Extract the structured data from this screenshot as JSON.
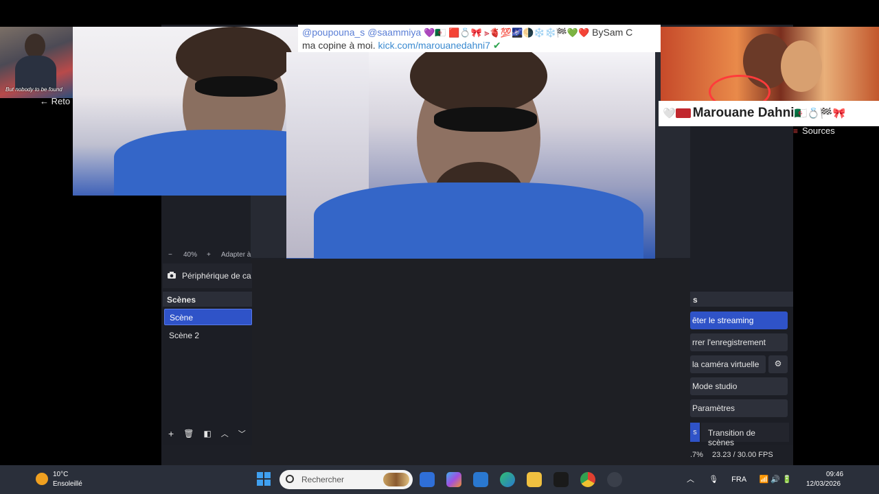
{
  "overlay": {
    "profile_caption": "But nobody to be found",
    "back_label": "← Reto",
    "chat": {
      "mention1": "@poupouna_s",
      "mention2": "@saammiya",
      "emojis": "💜🇩🇿 🟥💍🎀 ⫸🫀💯🌌🌗❄️❄️🏁💚❤️",
      "by": "BySam C",
      "line2_text": "ma copine à moi.",
      "line2_link": "kick.com/marouanedahni7",
      "verified": "✔"
    },
    "name_banner": {
      "prefix": "🤍",
      "name": "Marouane Dahni",
      "suffix": "🇩🇿💍🏁🎀"
    }
  },
  "obs": {
    "zoom": {
      "minus": "−",
      "value": "40%",
      "plus": "+",
      "fit": "Adapter à"
    },
    "source_toolbar": {
      "camera_label": "Périphérique de ca"
    },
    "scenes": {
      "title": "Scènes",
      "items": [
        {
          "label": "Scène"
        },
        {
          "label": "Scène 2"
        }
      ],
      "toolbar": {
        "add": "+",
        "remove": "🗑",
        "filter": "◧",
        "up": "︿",
        "down": "﹀"
      }
    },
    "sources_label": "Sources",
    "controls": {
      "title": "s",
      "stream": "êter le streaming",
      "record": "rrer l'enregistrement",
      "vcam": "la caméra virtuelle",
      "vcam_settings": "⚙",
      "studio": "Mode studio",
      "settings": "Paramètres"
    },
    "dock_tabs": {
      "left": "s",
      "transition": "Transition de scènes"
    },
    "status": {
      "cpu": ".7%",
      "fps": "23.23 / 30.00 FPS"
    }
  },
  "taskbar": {
    "weather_temp": "10°C",
    "weather_desc": "Ensoleillé",
    "search_placeholder": "Rechercher",
    "language": "FRA",
    "time": "09:46",
    "date": "12/03/2026"
  },
  "colors": {
    "accent": "#2f53c8",
    "panel": "#1d1f26",
    "taskbar": "#2a2f3a"
  }
}
